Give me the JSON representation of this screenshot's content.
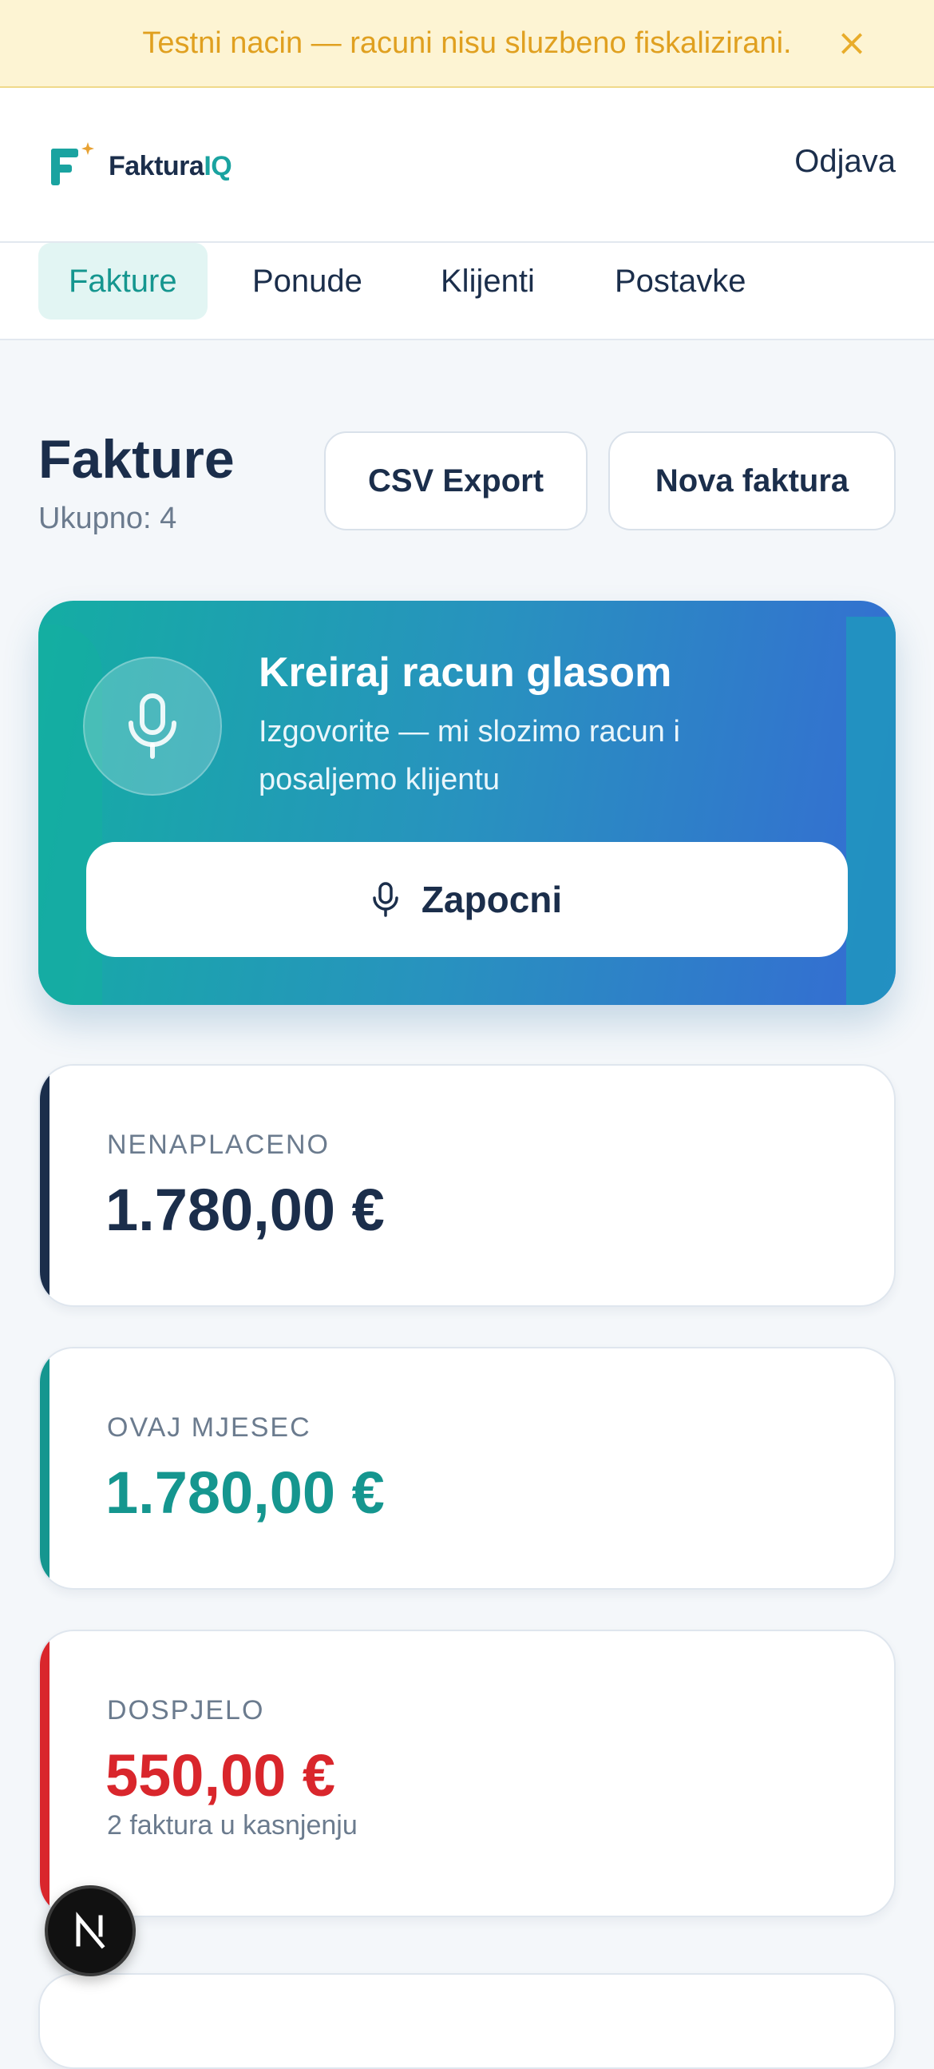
{
  "banner": {
    "text": "Testni nacin — racuni nisu sluzbeno fiskalizirani.",
    "close": "×"
  },
  "header": {
    "logo_part1": "Faktura",
    "logo_part2": "IQ",
    "logout": "Odjava"
  },
  "tabs": [
    {
      "label": "Fakture",
      "active": true
    },
    {
      "label": "Ponude",
      "active": false
    },
    {
      "label": "Klijenti",
      "active": false
    },
    {
      "label": "Postavke",
      "active": false
    }
  ],
  "page": {
    "title": "Fakture",
    "subtitle": "Ukupno: 4",
    "csv_button": "CSV Export",
    "new_button": "Nova faktura"
  },
  "voice": {
    "title": "Kreiraj racun glasom",
    "description": "Izgovorite — mi slozimo racun i posaljemo klijentu",
    "start_button": "Zapocni"
  },
  "stats": [
    {
      "label": "NENAPLACENO",
      "value": "1.780,00 €",
      "color": "#1b2e4b"
    },
    {
      "label": "OVAJ MJESEC",
      "value": "1.780,00 €",
      "color": "#15968f"
    },
    {
      "label": "DOSPJELO",
      "value": "550,00 €",
      "note": "2 faktura u kasnjenju",
      "color": "#d9262c"
    }
  ],
  "colors": {
    "accent": "#15968f",
    "brand": "#1b2e4b",
    "warning_text": "#e0a020",
    "danger": "#d9262c"
  },
  "icons": {
    "close": "close-icon",
    "mic": "microphone-icon",
    "badge": "nextjs-icon"
  }
}
